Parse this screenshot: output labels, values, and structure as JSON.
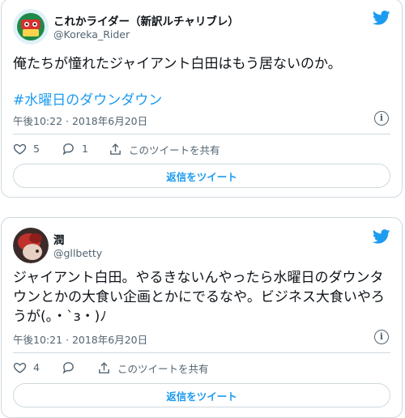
{
  "tweets": [
    {
      "name": "これかライダー（新訳ルチャリブレ）",
      "handle": "@Koreka_Rider",
      "text": "俺たちが憧れたジャイアント白田はもう居ないのか。",
      "hashtag": "#水曜日のダウンダウン",
      "time": "午後10:22 · 2018年6月20日",
      "likes": "5",
      "replies": "1",
      "share_label": "このツイートを共有",
      "reply_button": "返信をツイート"
    },
    {
      "name": "潤",
      "handle": "@gllbetty",
      "text": "ジャイアント白田。やるきないんやったら水曜日のダウンタウンとかの大食い企画とかにでるなや。ビジネス大食いやろうが(。・`з・)ﾉ",
      "time": "午後10:21 · 2018年6月20日",
      "likes": "4",
      "replies": "",
      "share_label": "このツイートを共有",
      "reply_button": "返信をツイート"
    }
  ],
  "colors": {
    "accent": "#1d9bf0",
    "like_red": "#f91880",
    "muted": "#536471"
  },
  "icons": [
    "twitter-bird-icon",
    "info-icon",
    "heart-icon",
    "reply-bubble-icon",
    "share-icon"
  ]
}
